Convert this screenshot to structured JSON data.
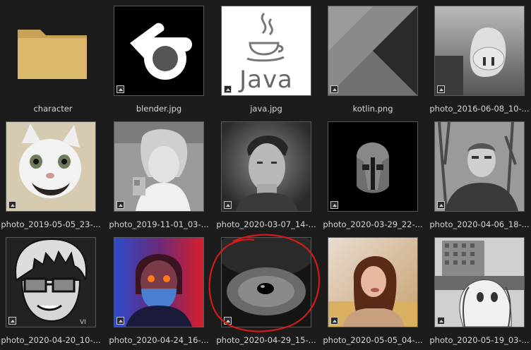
{
  "files": [
    {
      "name": "character",
      "type": "folder",
      "icon": "folder-icon"
    },
    {
      "name": "blender.jpg",
      "type": "image",
      "icon": "blender-logo-icon"
    },
    {
      "name": "java.jpg",
      "type": "image",
      "icon": "java-logo-icon",
      "logo_text": "Java"
    },
    {
      "name": "kotlin.png",
      "type": "image",
      "icon": "kotlin-logo-icon"
    },
    {
      "name": "photo_2016-06-08_10-...",
      "type": "image",
      "icon": "pig-mask-photo"
    },
    {
      "name": "photo_2019-05-05_23-...",
      "type": "image",
      "icon": "cat-photo"
    },
    {
      "name": "photo_2019-11-01_03-...",
      "type": "image",
      "icon": "anime-girl-photo"
    },
    {
      "name": "photo_2020-03-07_14-...",
      "type": "image",
      "icon": "man-portrait-photo"
    },
    {
      "name": "photo_2020-03-29_22-...",
      "type": "image",
      "icon": "spartan-helmet-photo"
    },
    {
      "name": "photo_2020-04-06_18-...",
      "type": "image",
      "icon": "man-outdoors-photo"
    },
    {
      "name": "photo_2020-04-20_10-...",
      "type": "image",
      "icon": "cartoon-glasses-photo"
    },
    {
      "name": "photo_2020-04-24_16-...",
      "type": "image",
      "icon": "masked-boy-photo"
    },
    {
      "name": "photo_2020-04-29_15-...",
      "type": "image",
      "icon": "plush-eye-photo"
    },
    {
      "name": "photo_2020-05-05_04-...",
      "type": "image",
      "icon": "girl-selfie-photo"
    },
    {
      "name": "photo_2020-05-19_03-...",
      "type": "image",
      "icon": "anime-city-photo"
    }
  ],
  "colors": {
    "background": "#1c1c1c",
    "folder": "#d9b56a",
    "highlight_circle": "#d41a1a"
  }
}
